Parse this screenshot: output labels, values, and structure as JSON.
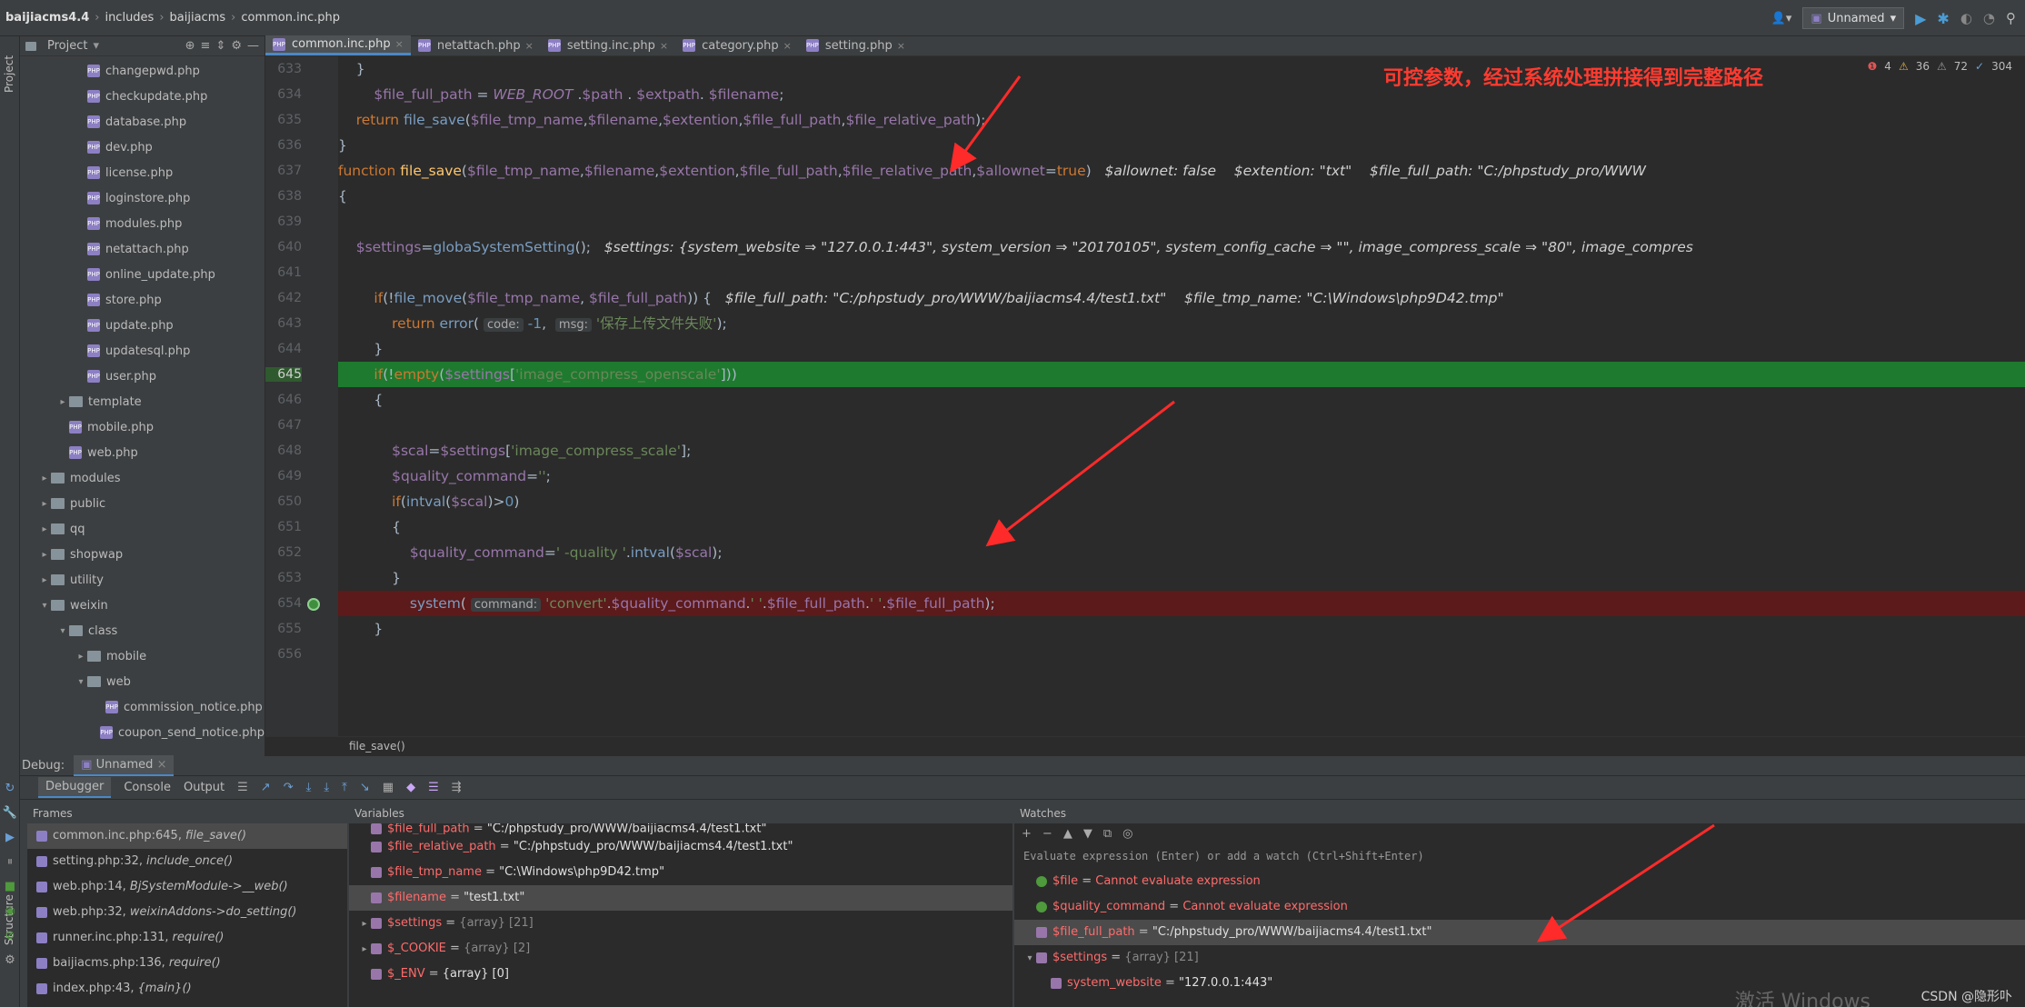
{
  "breadcrumb": [
    "baijiacms4.4",
    "includes",
    "baijiacms",
    "common.inc.php"
  ],
  "run_config": "Unnamed",
  "project_label": "Project",
  "project_tree": [
    {
      "label": "changepwd.php",
      "type": "php",
      "indent": 2
    },
    {
      "label": "checkupdate.php",
      "type": "php",
      "indent": 2
    },
    {
      "label": "database.php",
      "type": "php",
      "indent": 2
    },
    {
      "label": "dev.php",
      "type": "php",
      "indent": 2
    },
    {
      "label": "license.php",
      "type": "php",
      "indent": 2
    },
    {
      "label": "loginstore.php",
      "type": "php",
      "indent": 2
    },
    {
      "label": "modules.php",
      "type": "php",
      "indent": 2
    },
    {
      "label": "netattach.php",
      "type": "php",
      "indent": 2
    },
    {
      "label": "online_update.php",
      "type": "php",
      "indent": 2
    },
    {
      "label": "store.php",
      "type": "php",
      "indent": 2
    },
    {
      "label": "update.php",
      "type": "php",
      "indent": 2
    },
    {
      "label": "updatesql.php",
      "type": "php",
      "indent": 2
    },
    {
      "label": "user.php",
      "type": "php",
      "indent": 2
    },
    {
      "label": "template",
      "type": "folder",
      "indent": 1,
      "arrow": "right"
    },
    {
      "label": "mobile.php",
      "type": "php",
      "indent": 1
    },
    {
      "label": "web.php",
      "type": "php",
      "indent": 1
    },
    {
      "label": "modules",
      "type": "folder",
      "indent": 0,
      "arrow": "right"
    },
    {
      "label": "public",
      "type": "folder",
      "indent": 0,
      "arrow": "right"
    },
    {
      "label": "qq",
      "type": "folder",
      "indent": 0,
      "arrow": "right"
    },
    {
      "label": "shopwap",
      "type": "folder",
      "indent": 0,
      "arrow": "right"
    },
    {
      "label": "utility",
      "type": "folder",
      "indent": 0,
      "arrow": "right"
    },
    {
      "label": "weixin",
      "type": "folder",
      "indent": 0,
      "arrow": "down"
    },
    {
      "label": "class",
      "type": "folder",
      "indent": 1,
      "arrow": "down"
    },
    {
      "label": "mobile",
      "type": "folder",
      "indent": 2,
      "arrow": "right"
    },
    {
      "label": "web",
      "type": "folder",
      "indent": 2,
      "arrow": "down"
    },
    {
      "label": "commission_notice.php",
      "type": "php",
      "indent": 3
    },
    {
      "label": "coupon_send_notice.php",
      "type": "php",
      "indent": 3
    }
  ],
  "tabs": [
    {
      "label": "common.inc.php",
      "active": true
    },
    {
      "label": "netattach.php",
      "active": false
    },
    {
      "label": "setting.inc.php",
      "active": false
    },
    {
      "label": "category.php",
      "active": false
    },
    {
      "label": "setting.php",
      "active": false
    }
  ],
  "warnings": {
    "errors": "4",
    "warnings": "36",
    "weak": "72",
    "ok": "304"
  },
  "annotation": "可控参数，经过系统处理拼接得到完整路径",
  "line_numbers": [
    "633",
    "634",
    "635",
    "636",
    "637",
    "638",
    "639",
    "640",
    "641",
    "642",
    "643",
    "644",
    "645",
    "646",
    "647",
    "648",
    "649",
    "650",
    "651",
    "652",
    "653",
    "654",
    "655",
    "656"
  ],
  "current_function": "file_save()",
  "debug": {
    "label": "Debug:",
    "session": "Unnamed",
    "tabs": [
      "Debugger",
      "Console",
      "Output"
    ],
    "frames_header": "Frames",
    "variables_header": "Variables",
    "watches_header": "Watches",
    "watch_placeholder": "Evaluate expression (Enter) or add a watch (Ctrl+Shift+Enter)",
    "frames": [
      {
        "loc": "common.inc.php:645,",
        "fn": "file_save()",
        "selected": true
      },
      {
        "loc": "setting.php:32,",
        "fn": "include_once()"
      },
      {
        "loc": "web.php:14,",
        "fn": "BjSystemModule->__web()"
      },
      {
        "loc": "web.php:32,",
        "fn": "weixinAddons->do_setting()"
      },
      {
        "loc": "runner.inc.php:131,",
        "fn": "require()"
      },
      {
        "loc": "baijiacms.php:136,",
        "fn": "require()"
      },
      {
        "loc": "index.php:43,",
        "fn": "{main}()"
      }
    ],
    "variables": [
      {
        "name": "$file_full_path",
        "value": "\"C:/phpstudy_pro/WWW/baijiacms4.4/test1.txt\"",
        "partial": true
      },
      {
        "name": "$file_relative_path",
        "value": "\"C:/phpstudy_pro/WWW/baijiacms4.4/test1.txt\""
      },
      {
        "name": "$file_tmp_name",
        "value": "\"C:\\Windows\\php9D42.tmp\""
      },
      {
        "name": "$filename",
        "value": "\"test1.txt\"",
        "selected": true
      },
      {
        "name": "$settings",
        "value": "{array} [21]",
        "expandable": true
      },
      {
        "name": "$_COOKIE",
        "value": "{array} [2]",
        "expandable": true
      },
      {
        "name": "$_ENV",
        "value": "{array} [0]",
        "expandable": false
      }
    ],
    "watches": [
      {
        "name": "$file",
        "value": "Cannot evaluate expression",
        "error": true
      },
      {
        "name": "$quality_command",
        "value": "Cannot evaluate expression",
        "error": true
      },
      {
        "name": "$file_full_path",
        "value": "\"C:/phpstudy_pro/WWW/baijiacms4.4/test1.txt\"",
        "selected": true
      },
      {
        "name": "$settings",
        "value": "{array} [21]",
        "expandable": true
      },
      {
        "name": "system_website",
        "value": "\"127.0.0.1:443\"",
        "child": true
      }
    ]
  },
  "footer_credit": "CSDN @隐形卟",
  "watermark": "激活 Windows",
  "colors": {
    "exec_line": "#1e7a2e",
    "breakpoint_line": "#5c1a1a",
    "annotation": "#ff3b30",
    "accent": "#4a88c7"
  }
}
